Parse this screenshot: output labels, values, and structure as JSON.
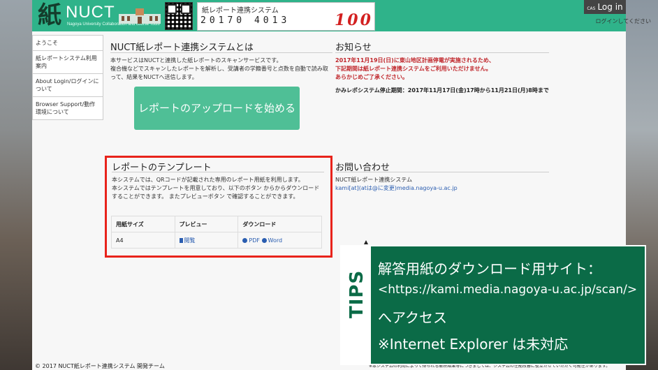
{
  "header": {
    "logo_kanji": "紙",
    "logo_text": "NUCT",
    "logo_sub": "Nagoya University Collaboration and course Tools",
    "paper_title": "紙レポート連携システム",
    "paper_digits": "20170 4013",
    "paper_score": "100",
    "login_cas": "CAS",
    "login_label": "Log in",
    "login_hint": "ログインしてください"
  },
  "sidebar": {
    "items": [
      {
        "label": "ようこそ"
      },
      {
        "label": "紙レポートシステム利用案内"
      },
      {
        "label": "About Login/ログインについて"
      },
      {
        "label": "Browser Support/動作環境について"
      }
    ]
  },
  "intro": {
    "title": "NUCT紙レポート連携システムとは",
    "body": "本サービスはNUCTと連携した紙レポートのスキャンサービスです。\n複合機などでスキャンしたレポートを解析し、受講者の学籍番号と点数を自動で読み取って、結果をNUCTへ送信します。",
    "upload_button": "レポートのアップロードを始める"
  },
  "news": {
    "title": "お知らせ",
    "alert": "2017年11月19日(日)に東山地区計画停電が実施されるため、\n下記期間は紙レポート連携システムをご利用いただけません。\nあらかじめご了承ください。",
    "period": "かみレポシステム停止期間：2017年11月17日(金)17時から11月21日(月)8時まで"
  },
  "templates": {
    "title": "レポートのテンプレート",
    "body": "本システムでは、QRコードが記載された専用のレポート用紙を利用します。\n本システムではテンプレートを用意しており、以下のボタン からからダウンロードすることができます。 またプレビューボタン で確認することができます。",
    "columns": [
      "用紙サイズ",
      "プレビュー",
      "ダウンロード"
    ],
    "rows": [
      {
        "size": "A4",
        "preview": "閲覧",
        "download_pdf": "PDF",
        "download_word": "Word"
      }
    ]
  },
  "contact": {
    "title": "お問い合わせ",
    "name": "NUCT紙レポート連携システム",
    "email": "kami[at](atは@に変更)media.nagoya-u.ac.jp"
  },
  "footer": {
    "copyright": "© 2017 NUCT紙レポート連携システム 開発チーム",
    "disclaimer": "※本システムの利用によって得られる解析結果等につきましては、システムの性能改善に役立たせていただく可能性があります。"
  },
  "tips": {
    "label": "TIPS",
    "line1": "解答用紙のダウンロード用サイト：",
    "line2": "<https://kami.media.nagoya-u.ac.jp/scan/>",
    "line3": "へアクセス",
    "line4": "※Internet Explorer は未対応"
  },
  "colors": {
    "header_green": "#2fb38a",
    "button_green": "#4fbf96",
    "alert_red": "#c0262b",
    "highlight_frame": "#e8231b",
    "tips_green": "#0b6b47"
  }
}
